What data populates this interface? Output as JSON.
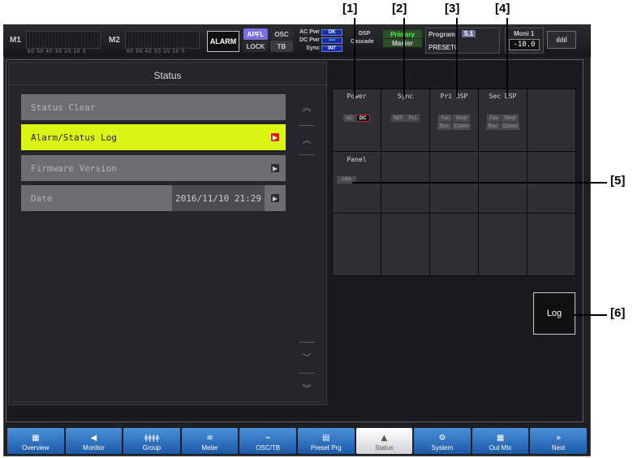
{
  "meters": {
    "m1_label": "M1",
    "m2_label": "M2",
    "scale": "60 50 40 30 20 10 0"
  },
  "header": {
    "alarm": "ALARM",
    "apfl": "APFL",
    "osc": "OSC",
    "lock": "LOCK",
    "tb": "TB",
    "ac_pwr_label": "AC Pwr",
    "ac_pwr_value": "OK",
    "dc_pwr_label": "DC Pwr",
    "dc_pwr_value": "----",
    "sync_label": "Sync",
    "sync_value": "INT",
    "dsp_label": "DSP",
    "cascade_label": "Cascade",
    "dsp_primary": "Primary",
    "dsp_master": "Master",
    "program_label": "Program",
    "program_value": "5.1",
    "program_name": "PRESET0",
    "moni_label": "Moni 1",
    "moni_value": "-10.0",
    "meter_btn": "ılılıl"
  },
  "status_panel": {
    "title": "Status",
    "items": [
      {
        "label": "Status Clear"
      },
      {
        "label": "Alarm/Status Log"
      },
      {
        "label": "Firmware Version"
      },
      {
        "label": "Date",
        "value": "2016/11/10 21:29"
      }
    ]
  },
  "grid": {
    "power": {
      "title": "Power",
      "ac": "AC",
      "dc": "DC"
    },
    "sync": {
      "title": "Sync",
      "ref": "REF",
      "pll": "PLL"
    },
    "pri_dsp": {
      "title": "Pri DSP",
      "fan": "Fan",
      "temp": "Temp",
      "run": "Run",
      "comm": "Comm"
    },
    "sec_dsp": {
      "title": "Sec DSP",
      "fan": "Fan",
      "temp": "Temp",
      "run": "Run",
      "comm": "Comm"
    },
    "panel": {
      "title": "Panel",
      "link": "Link"
    }
  },
  "log_button": "Log",
  "callouts": {
    "c1": "[1]",
    "c2": "[2]",
    "c3": "[3]",
    "c4": "[4]",
    "c5": "[5]",
    "c6": "[6]"
  },
  "nav": [
    {
      "label": "Overview",
      "icon": "▦"
    },
    {
      "label": "Monitor",
      "icon": "◀"
    },
    {
      "label": "Group",
      "icon": "ǂǂǂǂ"
    },
    {
      "label": "Meter",
      "icon": "≡"
    },
    {
      "label": "OSC/TB",
      "icon": "⌁"
    },
    {
      "label": "Preset Prg",
      "icon": "▤"
    },
    {
      "label": "Status",
      "icon": "▲"
    },
    {
      "label": "System",
      "icon": "⚙"
    },
    {
      "label": "Out Mtx",
      "icon": "▦"
    },
    {
      "label": "Next",
      "icon": "»"
    }
  ],
  "colors": {
    "active_item": "#ddf515",
    "alarm_red": "#d8201a",
    "nav_blue": "#1d5aa8"
  }
}
